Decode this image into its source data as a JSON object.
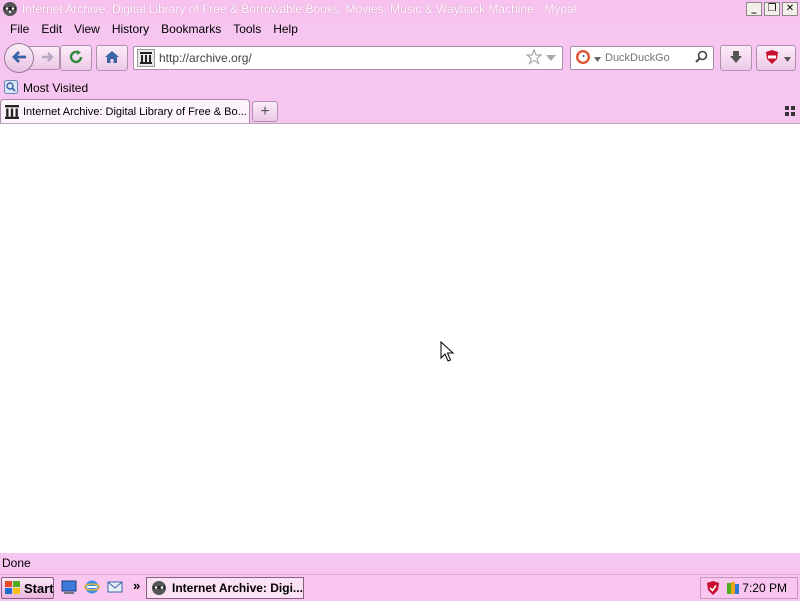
{
  "window": {
    "title": "Internet Archive: Digital Library of Free & Borrowable Books, Movies, Music & Wayback Machine - Mypal",
    "minimize_icon": "minimize-icon",
    "restore_icon": "restore-icon",
    "close_icon": "close-icon"
  },
  "menu": {
    "items": [
      "File",
      "Edit",
      "View",
      "History",
      "Bookmarks",
      "Tools",
      "Help"
    ]
  },
  "navigation": {
    "url": "http://archive.org/",
    "search_engine": "DuckDuckGo",
    "search_placeholder": "DuckDuckGo"
  },
  "bookmarks_bar": {
    "items": [
      "Most Visited"
    ]
  },
  "tabs": [
    {
      "title": "Internet Archive: Digital Library of Free & Bo..."
    }
  ],
  "status": {
    "text": "Done"
  },
  "taskbar": {
    "start_label": "Start",
    "quick_launch_more": "»",
    "task_label": "Internet Archive: Digi...",
    "clock": "7:20 PM"
  },
  "colors": {
    "chrome_pink": "#f7c6f0",
    "title_text": "#ffffff",
    "content_bg": "#ffffff"
  }
}
